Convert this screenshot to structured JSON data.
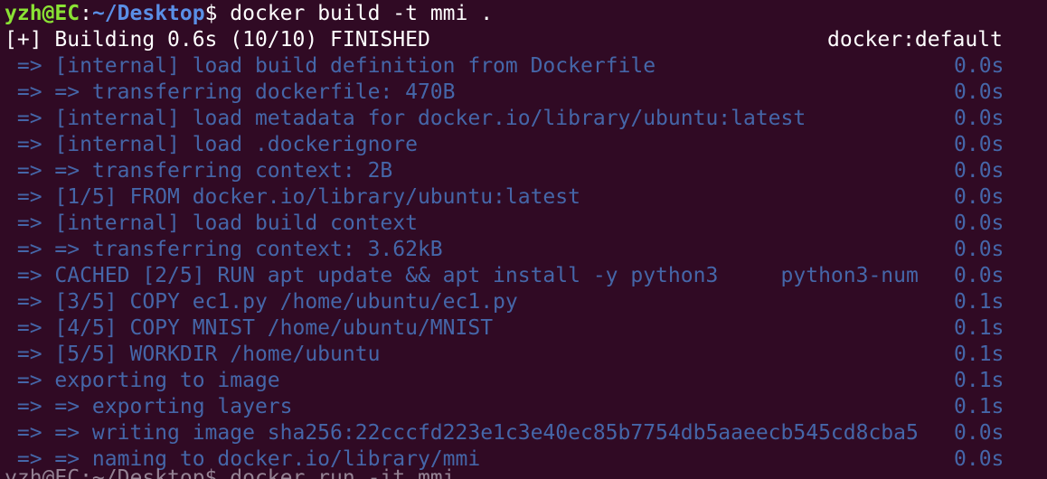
{
  "colors": {
    "background": "#300a24",
    "text": "#ffffff",
    "step_text": "#4566a8",
    "prompt_user": "#8ae234",
    "prompt_path": "#5a8fe6"
  },
  "prompt": {
    "user_host": "yzh@EC",
    "colon": ":",
    "path": "~/Desktop",
    "symbol": "$",
    "command": " docker build -t mmi ."
  },
  "status": {
    "summary": "[+] Building 0.6s (10/10) FINISHED",
    "builder": "docker:default"
  },
  "steps": [
    {
      "text": " => [internal] load build definition from Dockerfile",
      "duration": "0.0s"
    },
    {
      "text": " => => transferring dockerfile: 470B",
      "duration": "0.0s"
    },
    {
      "text": " => [internal] load metadata for docker.io/library/ubuntu:latest",
      "duration": "0.0s"
    },
    {
      "text": " => [internal] load .dockerignore",
      "duration": "0.0s"
    },
    {
      "text": " => => transferring context: 2B",
      "duration": "0.0s"
    },
    {
      "text": " => [1/5] FROM docker.io/library/ubuntu:latest",
      "duration": "0.0s"
    },
    {
      "text": " => [internal] load build context",
      "duration": "0.0s"
    },
    {
      "text": " => => transferring context: 3.62kB",
      "duration": "0.0s"
    },
    {
      "text": " => CACHED [2/5] RUN apt update && apt install -y python3     python3-num",
      "duration": "0.0s"
    },
    {
      "text": " => [3/5] COPY ec1.py /home/ubuntu/ec1.py",
      "duration": "0.1s"
    },
    {
      "text": " => [4/5] COPY MNIST /home/ubuntu/MNIST",
      "duration": "0.1s"
    },
    {
      "text": " => [5/5] WORKDIR /home/ubuntu",
      "duration": "0.1s"
    },
    {
      "text": " => exporting to image",
      "duration": "0.1s"
    },
    {
      "text": " => => exporting layers",
      "duration": "0.1s"
    },
    {
      "text": " => => writing image sha256:22cccfd223e1c3e40ec85b7754db5aaeecb545cd8cba5",
      "duration": "0.0s"
    },
    {
      "text": " => => naming to docker.io/library/mmi",
      "duration": "0.0s"
    }
  ],
  "next_prompt_partial": "yzh@EC:~/Desktop$ docker run -it mmi"
}
